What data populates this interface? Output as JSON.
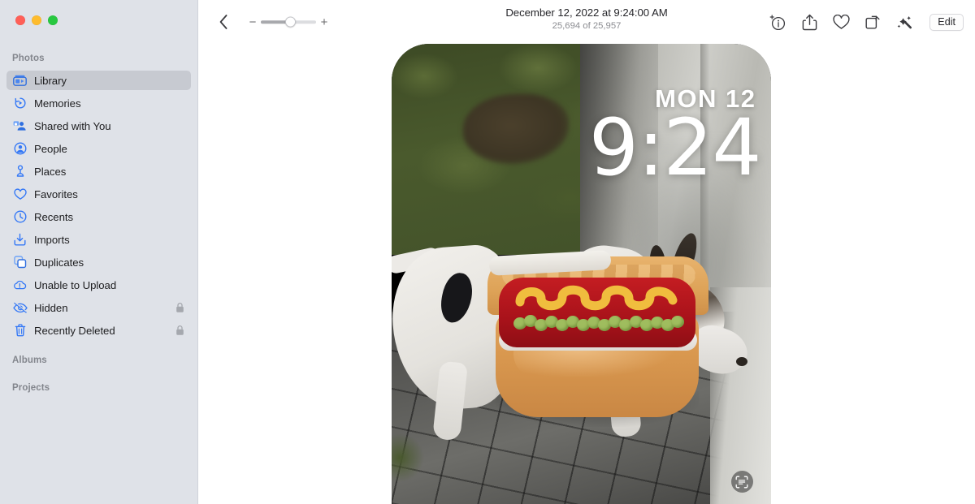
{
  "window": {
    "traffic_lights": [
      {
        "name": "close",
        "color": "#ff5f57"
      },
      {
        "name": "minimize",
        "color": "#febc2e"
      },
      {
        "name": "zoom",
        "color": "#28c840"
      }
    ]
  },
  "sidebar": {
    "sections": [
      {
        "header": "Photos",
        "items": [
          {
            "label": "Library",
            "icon": "library-icon",
            "selected": true,
            "locked": false
          },
          {
            "label": "Memories",
            "icon": "memories-icon",
            "selected": false,
            "locked": false
          },
          {
            "label": "Shared with You",
            "icon": "shared-with-you-icon",
            "selected": false,
            "locked": false
          },
          {
            "label": "People",
            "icon": "people-icon",
            "selected": false,
            "locked": false
          },
          {
            "label": "Places",
            "icon": "places-icon",
            "selected": false,
            "locked": false
          },
          {
            "label": "Favorites",
            "icon": "heart-icon",
            "selected": false,
            "locked": false
          },
          {
            "label": "Recents",
            "icon": "clock-icon",
            "selected": false,
            "locked": false
          },
          {
            "label": "Imports",
            "icon": "imports-icon",
            "selected": false,
            "locked": false
          },
          {
            "label": "Duplicates",
            "icon": "duplicates-icon",
            "selected": false,
            "locked": false
          },
          {
            "label": "Unable to Upload",
            "icon": "cloud-warning-icon",
            "selected": false,
            "locked": false
          },
          {
            "label": "Hidden",
            "icon": "eye-slash-icon",
            "selected": false,
            "locked": true
          },
          {
            "label": "Recently Deleted",
            "icon": "trash-icon",
            "selected": false,
            "locked": true
          }
        ]
      },
      {
        "header": "Albums",
        "items": []
      },
      {
        "header": "Projects",
        "items": []
      }
    ]
  },
  "toolbar": {
    "back_label": "Back",
    "zoom_out_label": "−",
    "zoom_in_label": "+",
    "zoom_value": 45,
    "title": "December 12, 2022 at 9:24:00 AM",
    "subtitle": "25,694 of 25,957",
    "actions": [
      {
        "name": "info-icon",
        "label": "Info"
      },
      {
        "name": "share-icon",
        "label": "Share"
      },
      {
        "name": "favorite-heart-icon",
        "label": "Favorite"
      },
      {
        "name": "rotate-icon",
        "label": "Rotate"
      },
      {
        "name": "auto-enhance-icon",
        "label": "Auto Enhance"
      }
    ],
    "edit_label": "Edit"
  },
  "photo": {
    "lock_screen_day": "MON 12",
    "lock_screen_time": "9:24",
    "live_text_label": "Live Text"
  }
}
